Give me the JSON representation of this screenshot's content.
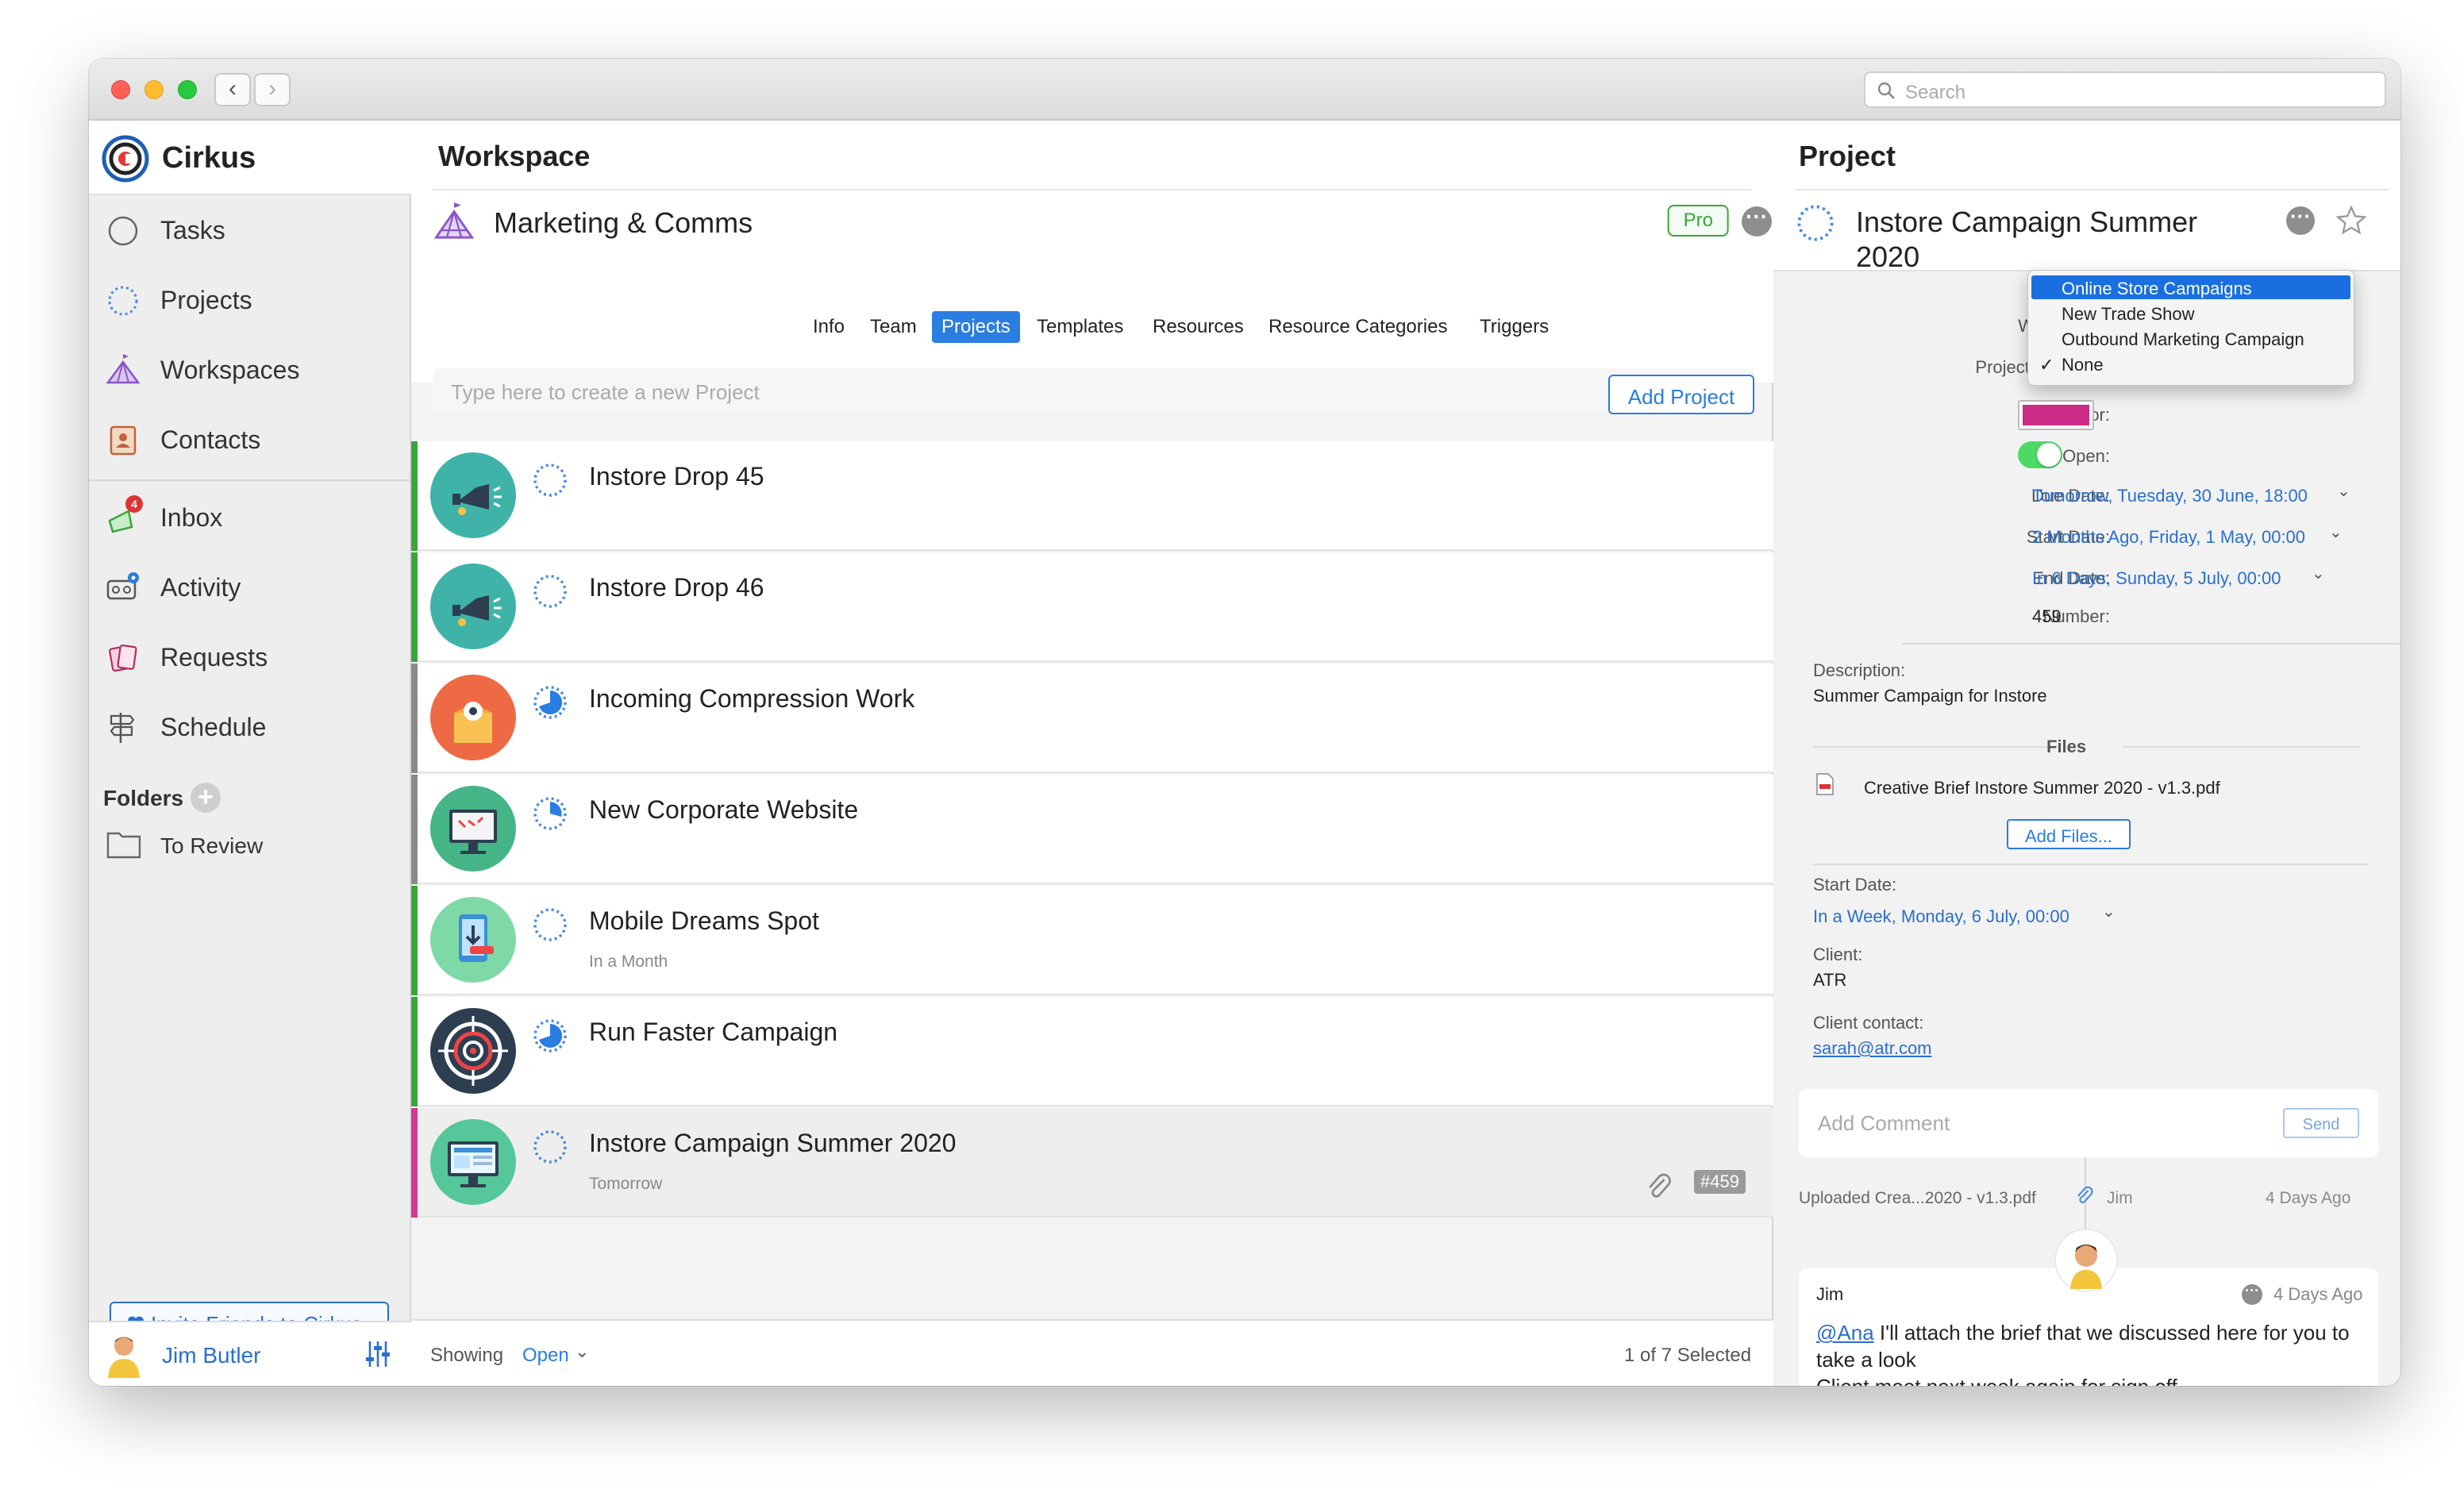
{
  "app": {
    "name": "Cirkus"
  },
  "search": {
    "placeholder": "Search"
  },
  "sidebar": {
    "items": [
      {
        "label": "Tasks",
        "icon": "circle-icon"
      },
      {
        "label": "Projects",
        "icon": "dotted-circle-icon"
      },
      {
        "label": "Workspaces",
        "icon": "tent-icon"
      },
      {
        "label": "Contacts",
        "icon": "contacts-book-icon"
      },
      {
        "label": "Inbox",
        "icon": "inbox-icon",
        "badge": "4"
      },
      {
        "label": "Activity",
        "icon": "activity-icon"
      },
      {
        "label": "Requests",
        "icon": "requests-icon"
      },
      {
        "label": "Schedule",
        "icon": "signpost-icon"
      }
    ],
    "folders_label": "Folders",
    "folders": [
      {
        "label": "To Review"
      }
    ],
    "invite_label": "Invite Friends to Cirkus",
    "user_name": "Jim Butler"
  },
  "workspace": {
    "header": "Workspace",
    "name": "Marketing & Comms",
    "plan_badge": "Pro",
    "tabs": [
      "Info",
      "Team",
      "Projects",
      "Templates",
      "Resources",
      "Resource Categories",
      "Triggers"
    ],
    "active_tab": "Projects",
    "new_project_placeholder": "Type here to create a new Project",
    "add_project_label": "Add Project",
    "projects": [
      {
        "name": "Instore Drop 45",
        "subtitle": "",
        "bar_color": "#3aa53a",
        "avatar": "megaphone-icon",
        "avatar_bg": "#3fb3a8",
        "status": "open"
      },
      {
        "name": "Instore Drop 46",
        "subtitle": "",
        "bar_color": "#3aa53a",
        "avatar": "megaphone-icon",
        "avatar_bg": "#3fb3a8",
        "status": "open"
      },
      {
        "name": "Incoming Compression Work",
        "subtitle": "",
        "bar_color": "#8a8a8a",
        "avatar": "package-gear-icon",
        "avatar_bg": "#ee6a45",
        "status": "in-progress"
      },
      {
        "name": "New Corporate Website",
        "subtitle": "",
        "bar_color": "#8a8a8a",
        "avatar": "monitor-icon",
        "avatar_bg": "#45b587",
        "status": "in-progress-small"
      },
      {
        "name": "Mobile Dreams Spot",
        "subtitle": "In a Month",
        "bar_color": "#3aa53a",
        "avatar": "mobile-download-icon",
        "avatar_bg": "#7fd9a7",
        "status": "open"
      },
      {
        "name": "Run Faster Campaign",
        "subtitle": "",
        "bar_color": "#3aa53a",
        "avatar": "target-icon",
        "avatar_bg": "#2d3e50",
        "status": "in-progress"
      },
      {
        "name": "Instore Campaign Summer 2020",
        "subtitle": "Tomorrow",
        "bar_color": "#d13a8e",
        "avatar": "desktop-icon",
        "avatar_bg": "#55c79b",
        "status": "open",
        "number_badge": "#459",
        "selected": true
      }
    ],
    "footer_showing": "Showing",
    "footer_filter": "Open",
    "footer_count": "1 of 7 Selected"
  },
  "project": {
    "header": "Project",
    "title": "Instore Campaign Summer 2020",
    "fields": {
      "workspace_label": "Workspace:",
      "template_label": "Project Template:",
      "color_label": "Color:",
      "color_value": "#cc2c86",
      "open_label": "Open:",
      "due_label": "Due Date:",
      "due_value": "Tomorrow, Tuesday, 30 June, 18:00",
      "start_label": "Start Date:",
      "start_value": "2 Months Ago, Friday, 1 May, 00:00",
      "end_label": "End Date:",
      "end_value": "In 6 Days, Sunday, 5 July, 00:00",
      "number_label": "Number:",
      "number_value": "459"
    },
    "dropdown": {
      "options": [
        "Online Store Campaigns",
        "New Trade Show",
        "Outbound Marketing Campaign",
        "None"
      ],
      "highlighted": "Online Store Campaigns",
      "checked": "None",
      "check_mark": "✓"
    },
    "description_label": "Description:",
    "description_value": "Summer Campaign for Instore",
    "files_label": "Files",
    "file_name": "Creative Brief Instore Summer 2020 - v1.3.pdf",
    "add_files_label": "Add Files...",
    "custom_start_label": "Start Date:",
    "custom_start_value": "In a Week, Monday, 6 July, 00:00",
    "client_label": "Client:",
    "client_value": "ATR",
    "client_contact_label": "Client contact:",
    "client_contact_value": "sarah@atr.com",
    "comment_placeholder": "Add Comment",
    "send_label": "Send",
    "activity": {
      "upload_text": "Uploaded Crea...2020 - v1.3.pdf",
      "upload_user": "Jim",
      "upload_time": "4 Days Ago",
      "comment_author": "Jim",
      "comment_time": "4 Days Ago",
      "comment_mention": "@Ana",
      "comment_text": " I'll attach the brief that we discussed here for you to take a look",
      "comment_text2": "Client meet next week again for sign off"
    }
  }
}
